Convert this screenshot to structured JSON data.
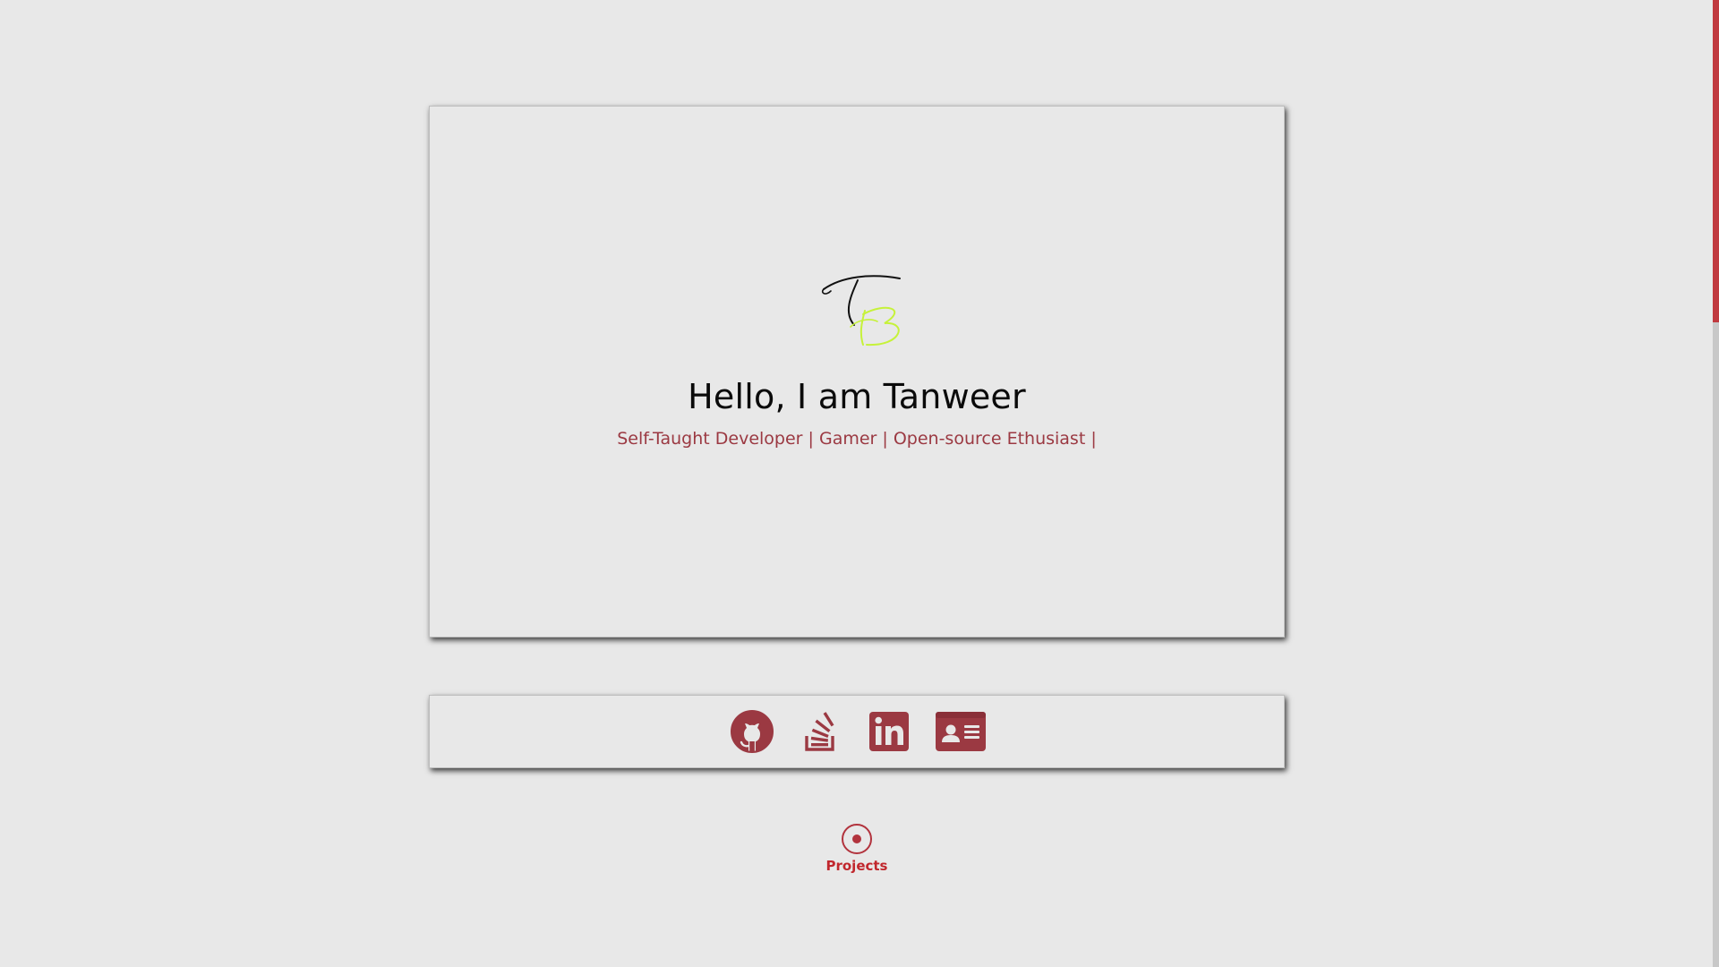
{
  "hero": {
    "logo_text": "TB",
    "greeting": "Hello, I am Tanweer",
    "tagline": "Self-Taught Developer | Gamer | Open-source Ethusiast |"
  },
  "social": {
    "links": [
      {
        "name": "GitHub",
        "icon": "github-icon"
      },
      {
        "name": "Stack Overflow",
        "icon": "stackoverflow-icon"
      },
      {
        "name": "LinkedIn",
        "icon": "linkedin-icon"
      },
      {
        "name": "Contact card",
        "icon": "id-card-icon"
      }
    ]
  },
  "nav": {
    "projects_label": "Projects"
  },
  "colors": {
    "accent": "#9b3942",
    "nav_accent": "#c1272d",
    "background": "#e8e8e8",
    "logo_t": "#111111",
    "logo_b": "#c6f23a"
  }
}
